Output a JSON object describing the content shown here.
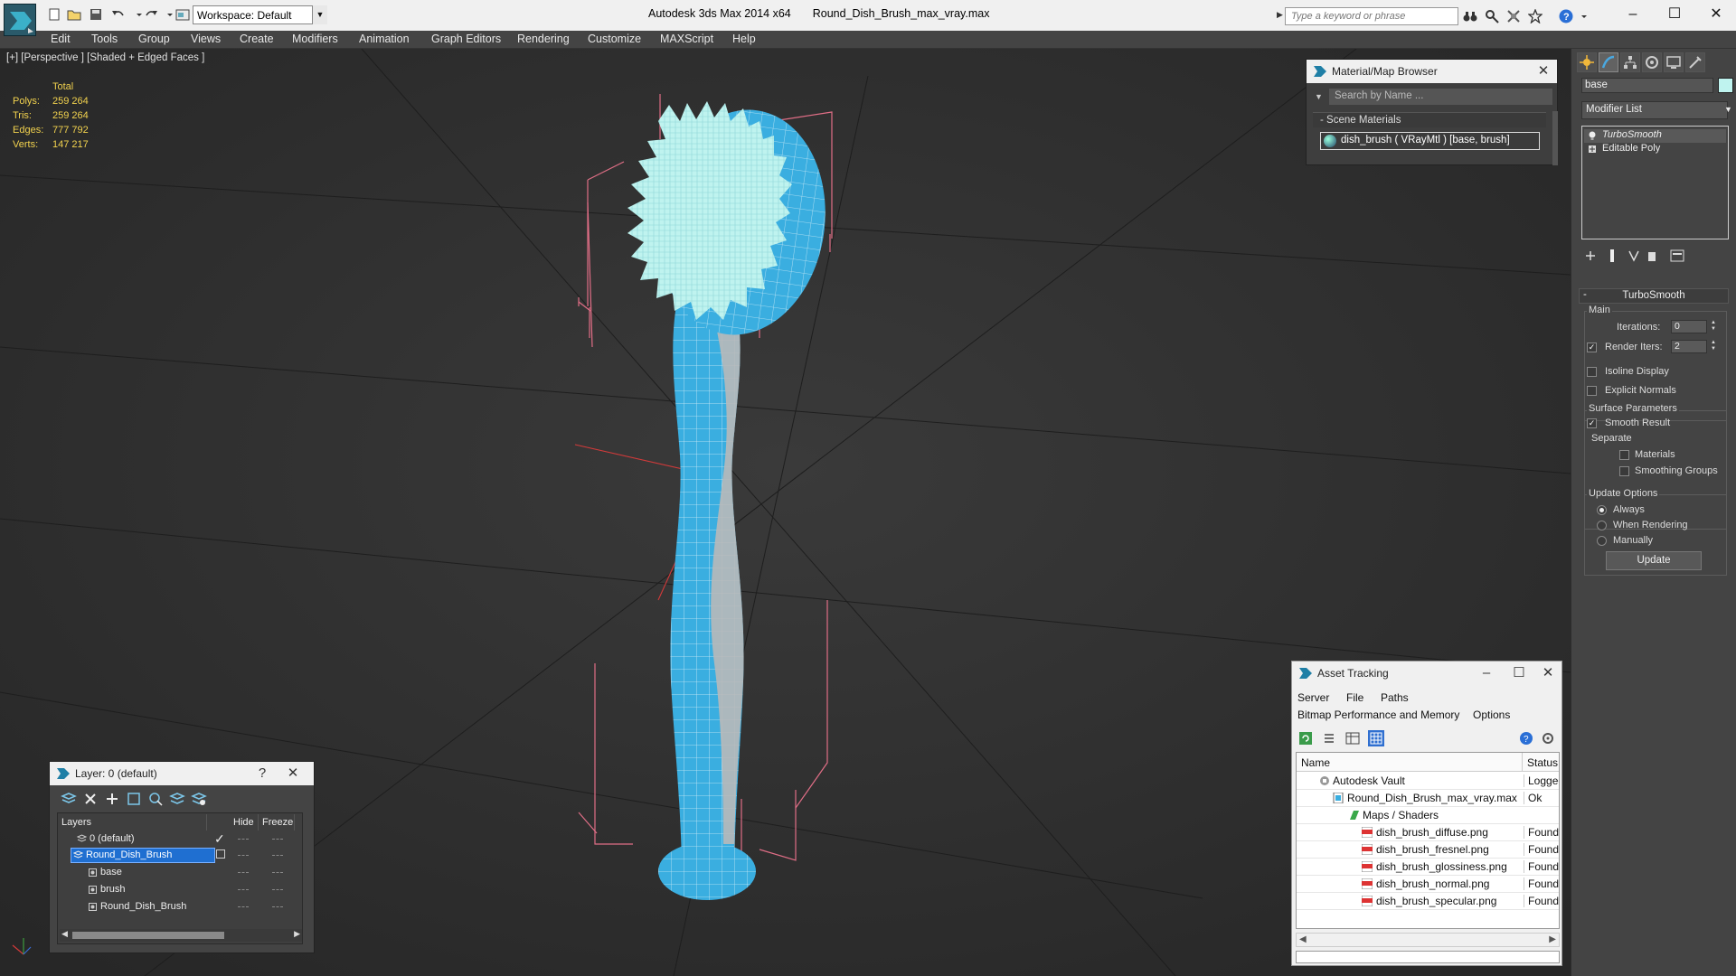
{
  "titlebar": {
    "workspace_label": "Workspace: Default",
    "app_name": "Autodesk 3ds Max  2014 x64",
    "file_name": "Round_Dish_Brush_max_vray.max",
    "search_placeholder": "Type a keyword or phrase"
  },
  "menu": [
    "Edit",
    "Tools",
    "Group",
    "Views",
    "Create",
    "Modifiers",
    "Animation",
    "Graph Editors",
    "Rendering",
    "Customize",
    "MAXScript",
    "Help"
  ],
  "viewport": {
    "label": "[+] [Perspective ] [Shaded + Edged Faces ]",
    "stats_header": "Total",
    "stats": [
      {
        "label": "Polys:",
        "value": "259 264"
      },
      {
        "label": "Tris:",
        "value": "259 264"
      },
      {
        "label": "Edges:",
        "value": "777 792"
      },
      {
        "label": "Verts:",
        "value": "147 217"
      }
    ],
    "stats_color": "#f2d24e",
    "mesh_color": "#3aaee0",
    "bristle_color": "#bff3ef"
  },
  "material_browser": {
    "title": "Material/Map Browser",
    "search_placeholder": "Search by Name ...",
    "section": "- Scene Materials",
    "item": "dish_brush  ( VRayMtl )  [base, brush]"
  },
  "command_panel": {
    "object_name": "base",
    "object_color": "#bff3ef",
    "modifier_list": "Modifier List",
    "stack": [
      "TurboSmooth",
      "Editable Poly"
    ],
    "rollout_title": "TurboSmooth",
    "main_label": "Main",
    "iterations_label": "Iterations:",
    "iterations_value": "0",
    "render_iters_label": "Render Iters:",
    "render_iters_value": "2",
    "isoline_label": "Isoline Display",
    "explicit_label": "Explicit Normals",
    "surface_label": "Surface Parameters",
    "smooth_label": "Smooth Result",
    "separate_label": "Separate",
    "materials_label": "Materials",
    "smoothing_groups_label": "Smoothing Groups",
    "update_options_label": "Update Options",
    "always_label": "Always",
    "when_rendering_label": "When Rendering",
    "manually_label": "Manually",
    "update_button": "Update"
  },
  "layer_panel": {
    "title": "Layer: 0 (default)",
    "help": "?",
    "col_layers": "Layers",
    "col_hide": "Hide",
    "col_freeze": "Freeze",
    "rows": [
      {
        "name": "0 (default)"
      },
      {
        "name": "Round_Dish_Brush"
      },
      {
        "name": "base"
      },
      {
        "name": "brush"
      },
      {
        "name": "Round_Dish_Brush"
      }
    ]
  },
  "asset_tracking": {
    "title": "Asset Tracking",
    "menu": [
      "Server",
      "File",
      "Paths",
      "Bitmap Performance and Memory",
      "Options"
    ],
    "col_name": "Name",
    "col_status": "Status",
    "rows": [
      {
        "name": "Autodesk Vault",
        "status": "Logged"
      },
      {
        "name": "Round_Dish_Brush_max_vray.max",
        "status": "Ok"
      },
      {
        "name": "Maps / Shaders",
        "status": ""
      },
      {
        "name": "dish_brush_diffuse.png",
        "status": "Found"
      },
      {
        "name": "dish_brush_fresnel.png",
        "status": "Found"
      },
      {
        "name": "dish_brush_glossiness.png",
        "status": "Found"
      },
      {
        "name": "dish_brush_normal.png",
        "status": "Found"
      },
      {
        "name": "dish_brush_specular.png",
        "status": "Found"
      }
    ]
  }
}
